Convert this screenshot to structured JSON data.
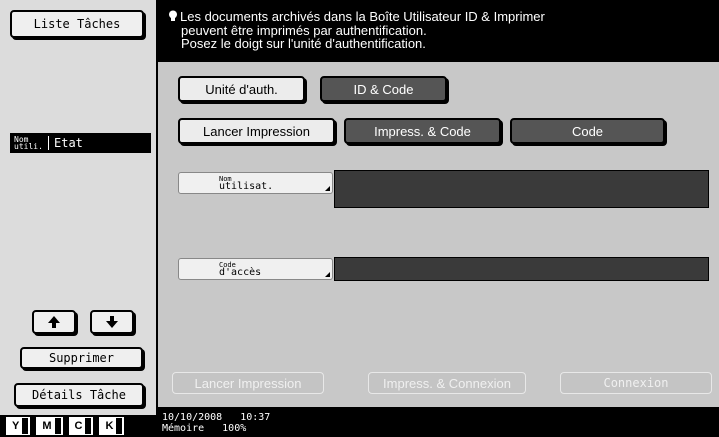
{
  "left": {
    "job_list_label": "Liste Tâches",
    "col_user_label": "Nom utili.",
    "col_user_line1": "Nom",
    "col_user_line2": "utili.",
    "col_state_label": "Etat",
    "delete_label": "Supprimer",
    "details_label": "Détails Tâche",
    "toner": [
      "Y",
      "M",
      "C",
      "K"
    ]
  },
  "message": {
    "line1": "Les documents archivés dans la Boîte Utilisateur ID & Imprimer",
    "line2": "peuvent être imprimés par authentification.",
    "line3": "Posez le doigt sur l'unité d'authentification."
  },
  "tabs": {
    "auth_unit": "Unité d'auth.",
    "id_code": "ID & Code"
  },
  "print_modes": {
    "launch_print": "Lancer Impression",
    "print_code": "Impress. & Code",
    "code": "Code"
  },
  "fields": {
    "username_line1": "Nom",
    "username_line2": "utilisat.",
    "username_value": "",
    "access_code_line1": "Code",
    "access_code_line2": "d'accès",
    "access_code_value": ""
  },
  "bottom": {
    "launch_print": "Lancer Impression",
    "print_connect": "Impress. & Connexion",
    "connect": "Connexion"
  },
  "status": {
    "date": "10/10/2008",
    "time": "10:37",
    "memory_label": "Mémoire",
    "memory_value": "100%"
  },
  "colors": {
    "background": "#000000",
    "panel": "#c8c8c8",
    "dark_button": "#555555",
    "field_value": "#3a3a3a"
  }
}
